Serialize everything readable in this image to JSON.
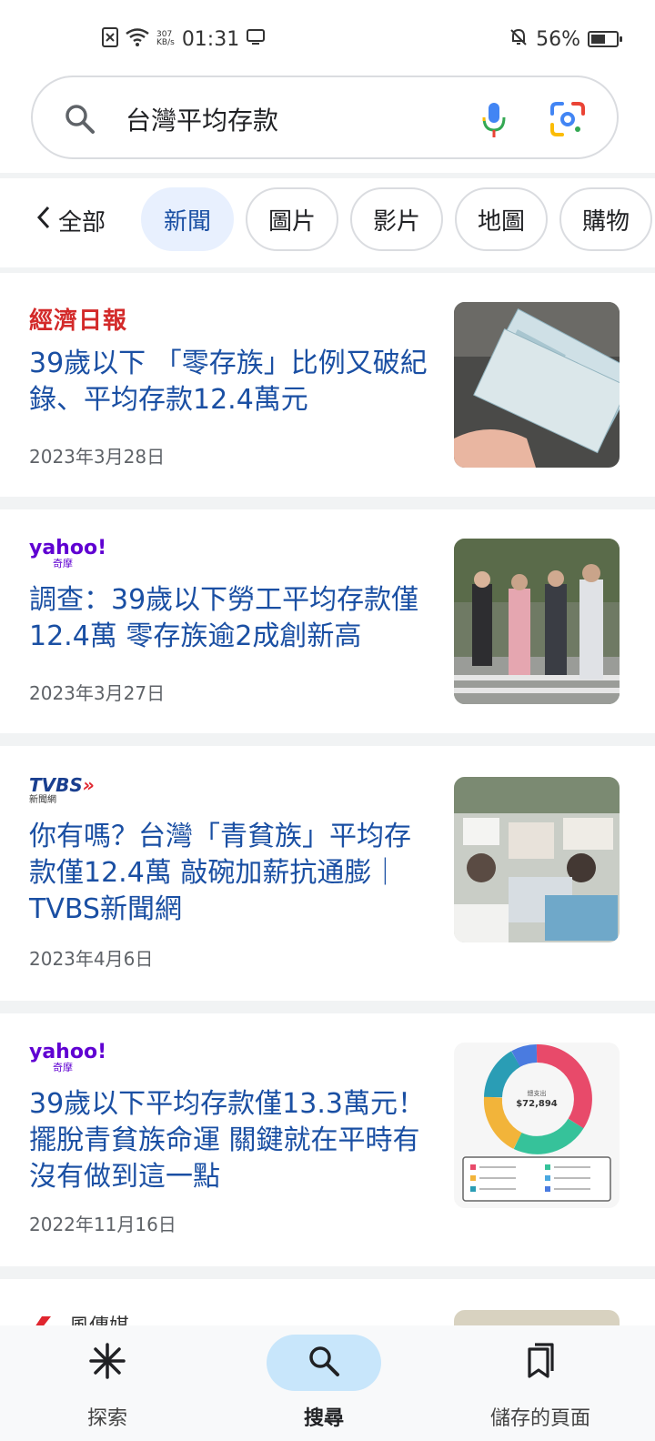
{
  "status_bar": {
    "netspeed_value": "307",
    "netspeed_unit": "KB/s",
    "time": "01:31",
    "battery": "56%",
    "battery_level": 0.56
  },
  "search": {
    "query": "台灣平均存款"
  },
  "tabs": {
    "back_label": "全部",
    "chips": [
      {
        "label": "新聞",
        "active": true
      },
      {
        "label": "圖片",
        "active": false
      },
      {
        "label": "影片",
        "active": false
      },
      {
        "label": "地圖",
        "active": false
      },
      {
        "label": "購物",
        "active": false
      }
    ]
  },
  "results": [
    {
      "source": "經濟日報",
      "headline": "39歲以下 「零存族」比例又破紀錄、平均存款12.4萬元",
      "date": "2023年3月28日"
    },
    {
      "source_main": "yahoo!",
      "source_sub": "奇摩",
      "headline": "調查：39歲以下勞工平均存款僅12.4萬 零存族逾2成創新高",
      "date": "2023年3月27日"
    },
    {
      "source_main": "TVBS",
      "source_sub": "新聞網",
      "headline": "你有嗎？台灣「青貧族」平均存款僅12.4萬 敲碗加薪抗通膨｜TVBS新聞網",
      "date": "2023年4月6日"
    },
    {
      "source_main": "yahoo!",
      "source_sub": "奇摩",
      "headline": "39歲以下平均存款僅13.3萬元！擺脫青貧族命運 關鍵就在平時有沒有做到這一點",
      "date": "2022年11月16日",
      "thumb_center_label": "總支出",
      "thumb_center_value": "$72,894"
    },
    {
      "source": "風傳媒"
    }
  ],
  "bottom_nav": {
    "items": [
      {
        "label": "探索",
        "active": false
      },
      {
        "label": "搜尋",
        "active": true
      },
      {
        "label": "儲存的頁面",
        "active": false
      }
    ]
  },
  "colors": {
    "link": "#1a4fa3",
    "chip_active_bg": "#e8f0fe",
    "nav_active_bg": "#c8e6fb"
  }
}
